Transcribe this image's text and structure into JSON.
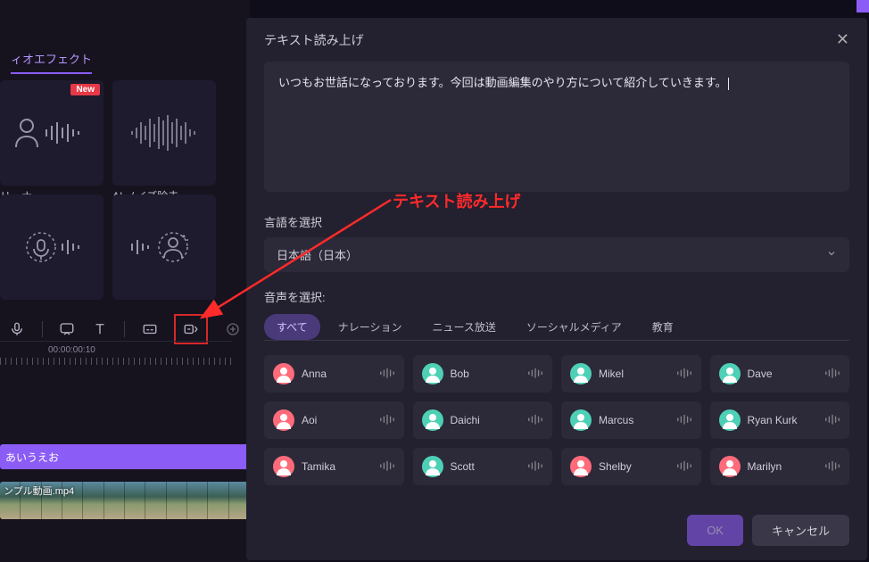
{
  "left_panel": {
    "tab": "ィオエフェクト",
    "effects": [
      {
        "label": "リーナー",
        "new": true,
        "icon": "person-wave"
      },
      {
        "label": "AI ノイズ除去",
        "new": false,
        "icon": "waveform"
      },
      {
        "label": "",
        "new": false,
        "icon": "mic-wave"
      },
      {
        "label": "",
        "new": false,
        "icon": "person-circle-wave"
      }
    ],
    "badge_new": "New",
    "toolbar": [
      "mic-icon",
      "speech-icon",
      "text-icon",
      "divider",
      "subtitle-icon",
      "tts-icon",
      "magic-icon"
    ],
    "timecode": "00:00:00:10",
    "track_text": "あいうえお",
    "track_video": "ンプル動画.mp4"
  },
  "dialog": {
    "title": "テキスト読み上げ",
    "text_value": "いつもお世話になっております。今回は動画編集のやり方について紹介していきます。",
    "lang_label": "言語を選択",
    "lang_value": "日本語（日本）",
    "voice_label": "音声を選択:",
    "tabs": [
      "すべて",
      "ナレーション",
      "ニュース放送",
      "ソーシャルメディア",
      "教育"
    ],
    "voices": [
      {
        "name": "Anna",
        "color": "#ff6b7a"
      },
      {
        "name": "Bob",
        "color": "#4dd0b5"
      },
      {
        "name": "Mikel",
        "color": "#4dd0b5"
      },
      {
        "name": "Dave",
        "color": "#4dd0b5"
      },
      {
        "name": "Aoi",
        "color": "#ff6b7a"
      },
      {
        "name": "Daichi",
        "color": "#4dd0b5"
      },
      {
        "name": "Marcus",
        "color": "#4dd0b5"
      },
      {
        "name": "Ryan Kurk",
        "color": "#4dd0b5"
      },
      {
        "name": "Tamika",
        "color": "#ff6b7a"
      },
      {
        "name": "Scott",
        "color": "#4dd0b5"
      },
      {
        "name": "Shelby",
        "color": "#ff6b7a"
      },
      {
        "name": "Marilyn",
        "color": "#ff6b7a"
      }
    ],
    "ok": "OK",
    "cancel": "キャンセル"
  },
  "annotation": "テキスト読み上げ"
}
